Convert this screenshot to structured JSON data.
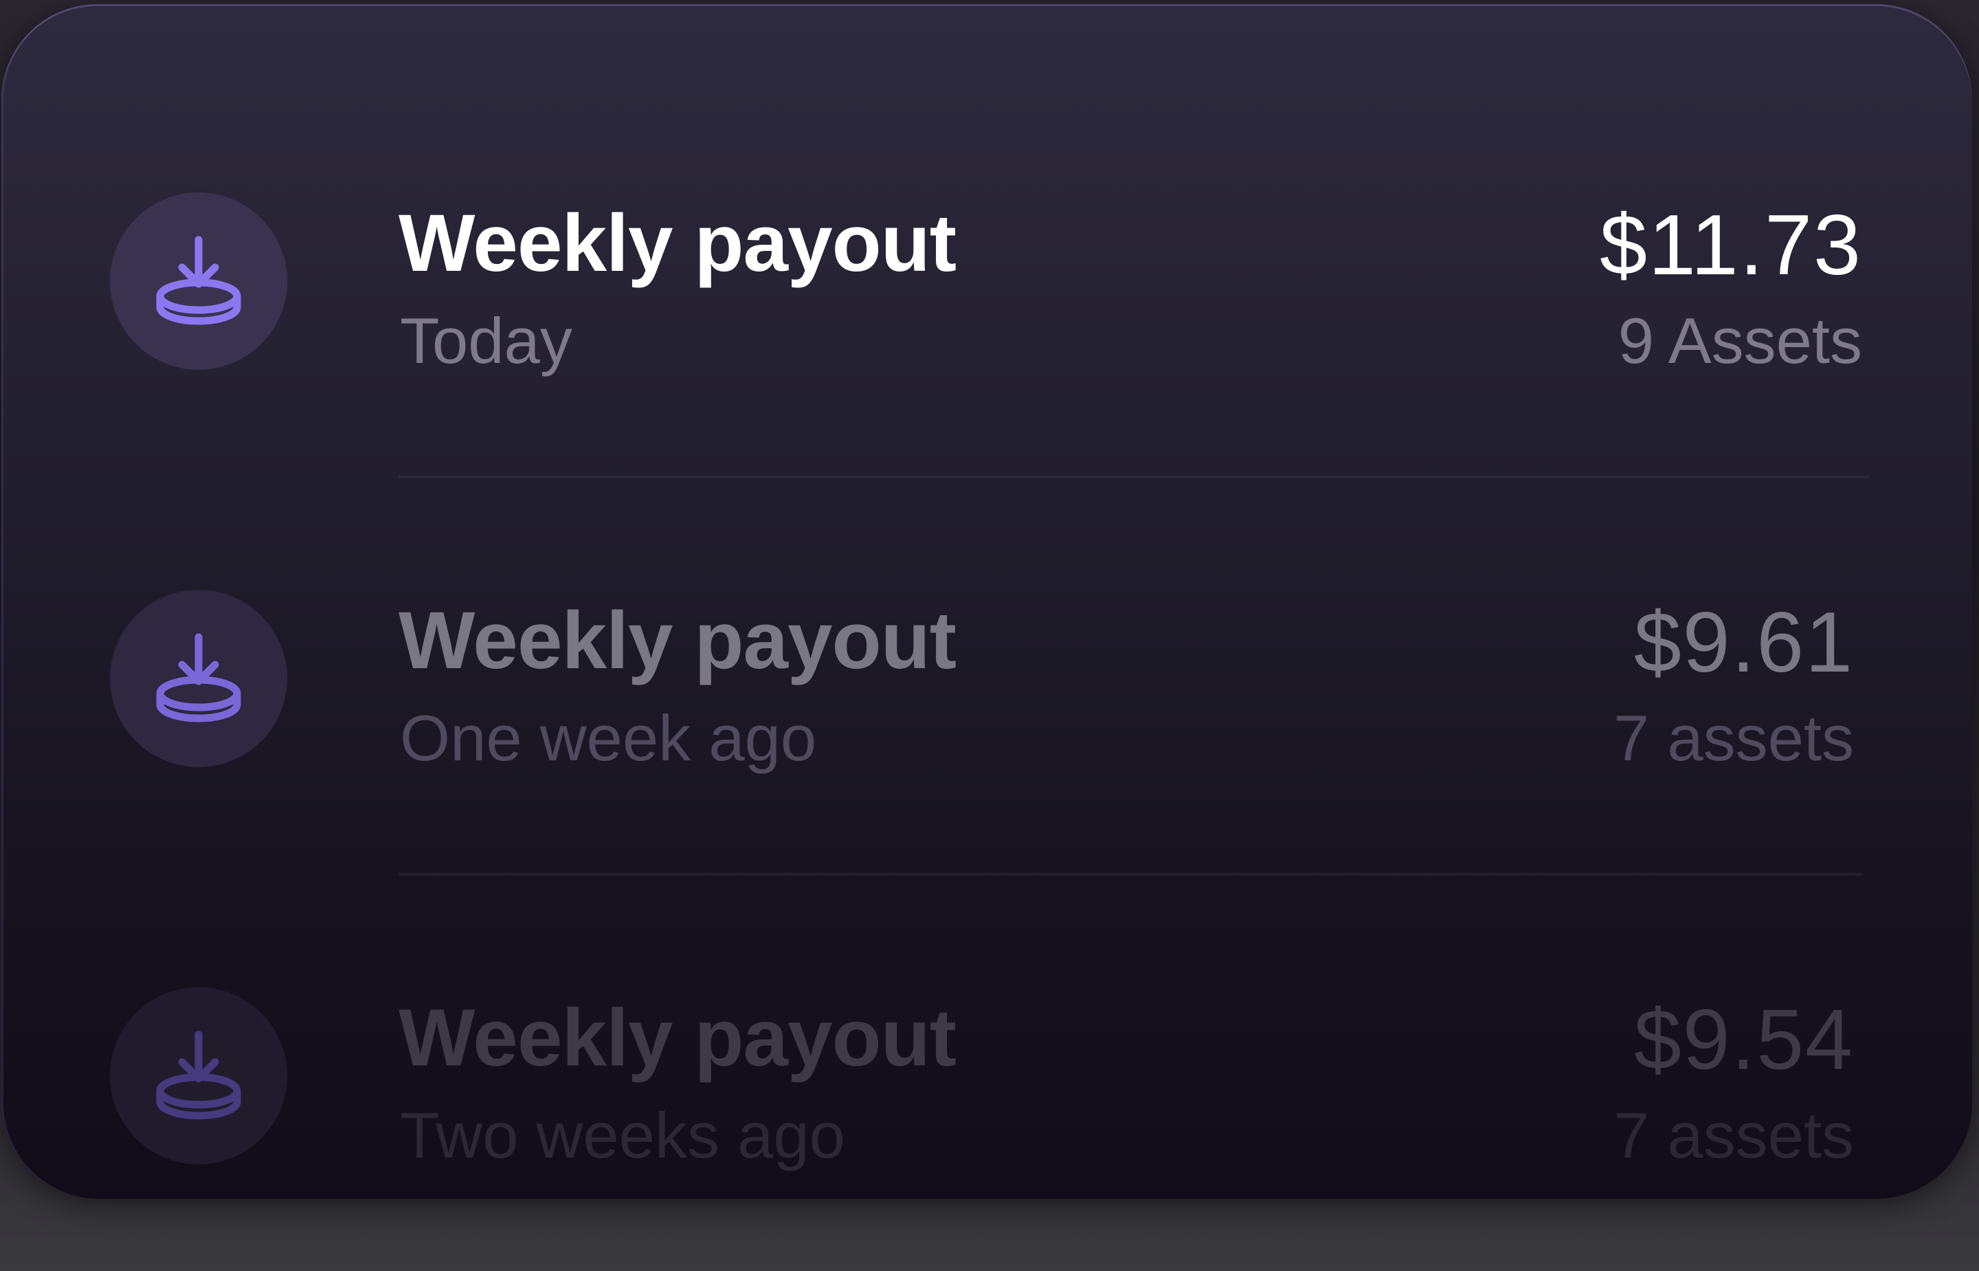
{
  "payouts": [
    {
      "title": "Weekly payout",
      "date": "Today",
      "amount": "$11.73",
      "assets": "9 Assets"
    },
    {
      "title": "Weekly payout",
      "date": "One week ago",
      "amount": "$9.61",
      "assets": "7 assets"
    },
    {
      "title": "Weekly payout",
      "date": "Two weeks ago",
      "amount": "$9.54",
      "assets": "7 assets"
    }
  ],
  "icons": {
    "payout": "download-coin-icon"
  },
  "colors": {
    "accent": "#8b78f0",
    "icon_bg": "#3a3350",
    "card_top": "#2e2a3e",
    "card_bottom": "#100c18",
    "primary_text": "#ffffff",
    "secondary_text": "#7e7a8c"
  }
}
